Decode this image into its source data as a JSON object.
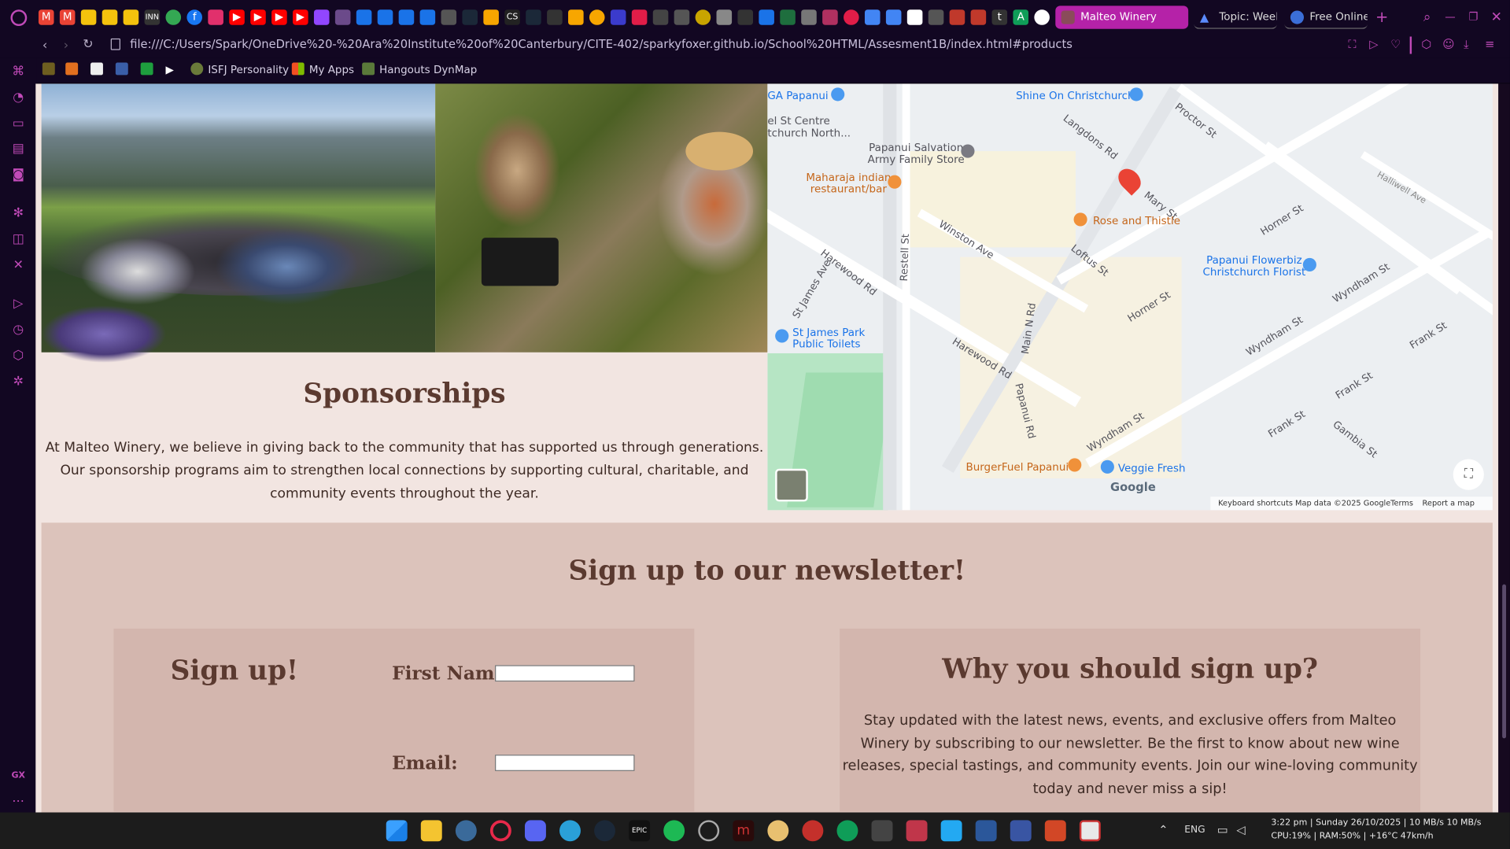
{
  "tabs": {
    "active": "Malteo Winery",
    "second": "Topic: Week",
    "third": "Free Online"
  },
  "address_bar": {
    "url": "file:///C:/Users/Spark/OneDrive%20-%20Ara%20Institute%20of%20Canterbury/CITE-402/sparkyfoxer.github.io/School%20HTML/Assesment1B/index.html#products"
  },
  "bookmarks": [
    "ISFJ Personality",
    "My Apps",
    "Hangouts DynMap"
  ],
  "page": {
    "sponsor_title": "Sponsorships",
    "sponsor_text": "At Malteo Winery, we believe in giving back to the community that has supported us through generations. Our sponsorship programs aim to strengthen local connections by supporting cultural, charitable, and community events throughout the year.",
    "newsletter_title": "Sign up to our newsletter!",
    "signup_heading": "Sign up!",
    "first_name_label": "First Name:",
    "email_label": "Email:",
    "why_heading": "Why you should sign up?",
    "why_text": "Stay updated with the latest news, events, and exclusive offers from Malteo Winery by subscribing to our newsletter. Be the first to know about new wine releases, special tastings, and community events. Join our wine-loving community today and never miss a sip!"
  },
  "map": {
    "pois": [
      "GA Papanui",
      "Shine On Christchurch",
      "el St Centre\ntchurch North...",
      "Papanui Salvation\nArmy Family Store",
      "Maharaja indian\nrestaurant/bar",
      "Rose and Thistle",
      "Papanui Flowerbiz\nChristchurch Florist",
      "St James Park\nPublic Toilets",
      "BurgerFuel Papanui",
      "Veggie Fresh"
    ],
    "streets": [
      "Langdons Rd",
      "Proctor St",
      "Mary St",
      "Halliwell Ave",
      "Winston Ave",
      "Loftus St",
      "Horner St",
      "Restell St",
      "Harewood Rd",
      "St James Ave",
      "Main N Rd",
      "Papanui Rd",
      "Wyndham St",
      "Frank St",
      "Gambia St"
    ],
    "footer": {
      "keyboard": "Keyboard shortcuts",
      "data": "Map data ©2025 Google",
      "terms": "Terms",
      "report": "Report a map error"
    },
    "logo": "Google"
  },
  "taskbar": {
    "lang": "ENG",
    "time": "3:22 pm | Sunday 26/10/2025 | 10 MB/s 10 MB/s",
    "stats": "CPU:19% | RAM:50% | +16°C 47km/h"
  }
}
